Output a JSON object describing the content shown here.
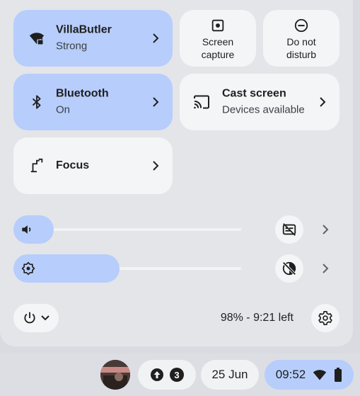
{
  "tiles": {
    "wifi": {
      "title": "VillaButler",
      "subtitle": "Strong",
      "icon": "wifi-lock-icon",
      "active": true
    },
    "bluetooth": {
      "title": "Bluetooth",
      "subtitle": "On",
      "icon": "bluetooth-icon",
      "active": true
    },
    "focus": {
      "title": "Focus",
      "icon": "focus-icon",
      "active": false
    },
    "screen_capture": {
      "label": "Screen capture",
      "icon": "screen-capture-icon"
    },
    "do_not_disturb": {
      "label": "Do not disturb",
      "icon": "do-not-disturb-icon"
    },
    "cast": {
      "title": "Cast screen",
      "subtitle": "Devices available",
      "icon": "cast-icon"
    }
  },
  "sliders": {
    "volume": {
      "icon": "volume-icon",
      "level": 0.06,
      "side_button_icon": "caption-off-icon"
    },
    "brightness": {
      "icon": "brightness-icon",
      "level": 0.39,
      "side_button_icon": "night-light-off-icon"
    }
  },
  "footer": {
    "battery_text": "98% - 9:21 left",
    "power_icon": "power-icon",
    "settings_icon": "settings-icon"
  },
  "shelf": {
    "notification_count": "3",
    "date": "25 Jun",
    "time": "09:52",
    "icons": [
      "avatar",
      "upload-icon",
      "wifi-icon",
      "battery-icon"
    ]
  },
  "colors": {
    "accent": "#b7cdfb",
    "tile": "#f4f5f7",
    "panel": "#e3e5e9"
  }
}
